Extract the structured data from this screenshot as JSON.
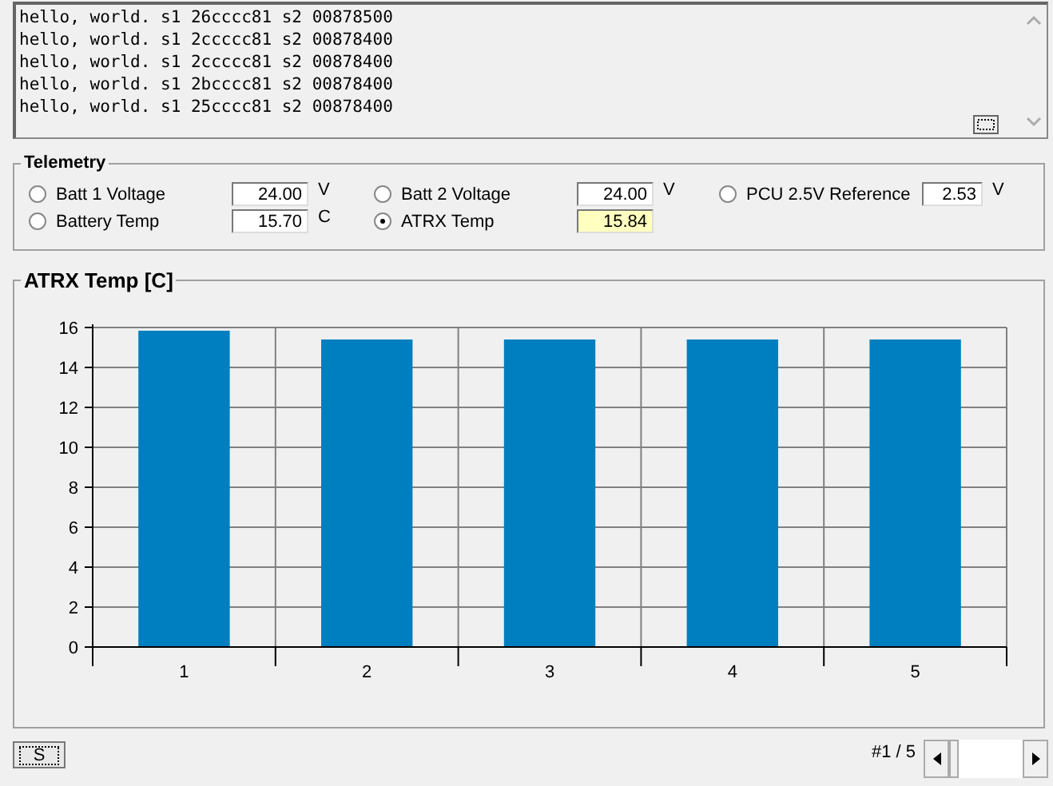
{
  "log": {
    "lines": [
      "hello, world. s1 26cccc81 s2 00878500",
      "hello, world. s1 2ccccc81 s2 00878400",
      "hello, world. s1 2ccccc81 s2 00878400",
      "hello, world. s1 2bcccc81 s2 00878400",
      "hello, world. s1 25cccc81 s2 00878400"
    ]
  },
  "telemetry": {
    "title": "Telemetry",
    "items": [
      {
        "label": "Batt 1 Voltage",
        "value": "24.00",
        "unit": "V",
        "selected": false
      },
      {
        "label": "Batt 2 Voltage",
        "value": "24.00",
        "unit": "V",
        "selected": false
      },
      {
        "label": "PCU 2.5V Reference",
        "value": "2.53",
        "unit": "V",
        "selected": false
      },
      {
        "label": "Battery Temp",
        "value": "15.70",
        "unit": "C",
        "selected": false
      },
      {
        "label": "ATRX Temp",
        "value": "15.84",
        "selected": true
      }
    ]
  },
  "chart": {
    "title": "ATRX Temp [C]",
    "chart_data": {
      "type": "bar",
      "categories": [
        "1",
        "2",
        "3",
        "4",
        "5"
      ],
      "series": [
        {
          "color": "#007fc0",
          "values": [
            15.84,
            15.4,
            15.4,
            15.4,
            15.4
          ]
        }
      ],
      "grid": true,
      "ylim": [
        0,
        16
      ],
      "yticks": [
        0,
        2,
        4,
        6,
        8,
        10,
        12,
        14,
        16
      ]
    }
  },
  "footer": {
    "button": "S",
    "page": "#1 / 5"
  }
}
